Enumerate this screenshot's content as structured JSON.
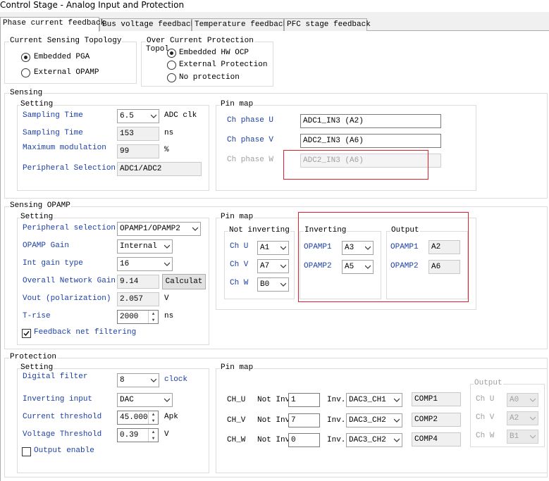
{
  "window": {
    "title": "Control Stage - Analog Input and Protection"
  },
  "tabs": [
    "Phase current feedback",
    "Bus voltage feedback",
    "Temperature feedback",
    "PFC stage feedback"
  ],
  "topology": {
    "title": "Current Sensing Topology",
    "options": [
      "Embedded PGA",
      "External OPAMP"
    ],
    "selected": "Embedded PGA"
  },
  "ocp": {
    "title": "Over Current Protection",
    "title_clip": "Topol",
    "options": [
      "Embedded HW OCP",
      "External Protection",
      "No protection"
    ],
    "selected": "Embedded HW OCP"
  },
  "sensing": {
    "title": "Sensing",
    "setting_title": "Setting",
    "sampling_time_label": "Sampling Time",
    "sampling_time_value": "6.5",
    "sampling_time_unit": "ADC clk",
    "sampling_time_ns_label": "Sampling Time",
    "sampling_time_ns_value": "153",
    "sampling_time_ns_unit": "ns",
    "max_mod_label": "Maximum modulation",
    "max_mod_value": "99",
    "max_mod_unit": "%",
    "periph_label": "Peripheral Selection",
    "periph_value": "ADC1/ADC2",
    "pinmap_title": "Pin map",
    "ch_u_label": "Ch phase U",
    "ch_u_value": "ADC1_IN3 (A2)",
    "ch_v_label": "Ch phase V",
    "ch_v_value": "ADC2_IN3 (A6)",
    "ch_w_label": "Ch phase W",
    "ch_w_value": "ADC2_IN3 (A6)"
  },
  "opamp": {
    "title": "Sensing OPAMP",
    "setting_title": "Setting",
    "periph_label": "Peripheral selection",
    "periph_value": "OPAMP1/OPAMP2",
    "gain_label": "OPAMP Gain",
    "gain_value": "Internal",
    "int_gain_label": "Int gain type",
    "int_gain_value": "16",
    "overall_label": "Overall Network Gain",
    "overall_value": "9.14",
    "calc_label": "Calculat",
    "vout_label": "Vout (polarization)",
    "vout_value": "2.057",
    "vout_unit": "V",
    "trise_label": "T-rise",
    "trise_value": "2000",
    "trise_unit": "ns",
    "feedback_label": "Feedback net filtering",
    "feedback_checked": true,
    "pinmap_title": "Pin map",
    "noninv_title": "Not inverting",
    "noninv": [
      {
        "label": "Ch U",
        "value": "A1"
      },
      {
        "label": "Ch V",
        "value": "A7"
      },
      {
        "label": "Ch W",
        "value": "B0"
      }
    ],
    "inv_title": "Inverting",
    "inv": [
      {
        "label": "OPAMP1",
        "value": "A3"
      },
      {
        "label": "OPAMP2",
        "value": "A5"
      }
    ],
    "out_title": "Output",
    "out": [
      {
        "label": "OPAMP1",
        "value": "A2"
      },
      {
        "label": "OPAMP2",
        "value": "A6"
      }
    ]
  },
  "protection": {
    "title": "Protection",
    "setting_title": "Setting",
    "digital_filter_label": "Digital filter",
    "digital_filter_value": "8",
    "digital_filter_unit": "clock",
    "inv_input_label": "Inverting input",
    "inv_input_value": "DAC",
    "cur_thr_label": "Current threshold",
    "cur_thr_value": "45.000",
    "cur_thr_unit": "Apk",
    "volt_thr_label": "Voltage Threshold",
    "volt_thr_value": "0.39",
    "volt_thr_unit": "V",
    "output_enable_label": "Output enable",
    "output_enable_checked": false,
    "pinmap_title": "Pin map",
    "not_inv_label": "Not Inv.",
    "inv_label": "Inv.",
    "rows": [
      {
        "ch": "CH_U",
        "not_inv": "1",
        "inv": "DAC3_CH1",
        "comp": "COMP1"
      },
      {
        "ch": "CH_V",
        "not_inv": "7",
        "inv": "DAC3_CH2",
        "comp": "COMP2"
      },
      {
        "ch": "CH_W",
        "not_inv": "0",
        "inv": "DAC3_CH2",
        "comp": "COMP4"
      }
    ],
    "output_title": "Output",
    "outputs": [
      {
        "label": "Ch U",
        "value": "A0"
      },
      {
        "label": "Ch V",
        "value": "A2"
      },
      {
        "label": "Ch W",
        "value": "B1"
      }
    ]
  },
  "colors": {
    "label_blue": "#1c3fa6",
    "highlight_red": "#e0212b",
    "disabled_gray": "#a0a0a0"
  }
}
